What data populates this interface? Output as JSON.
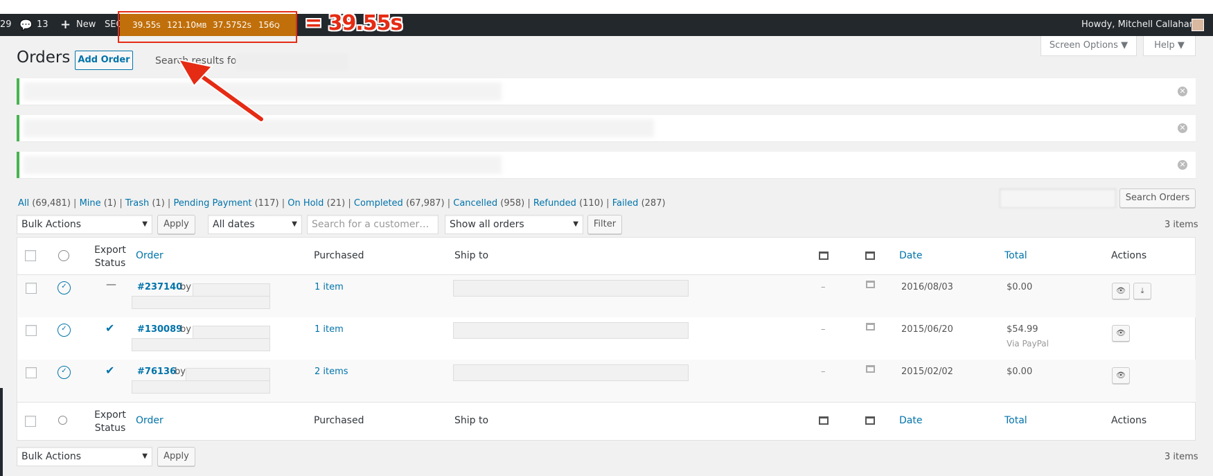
{
  "adminbar": {
    "updates_count": "29",
    "comments_count": "13",
    "new_label": "New",
    "seo_label": "SEO",
    "qm_time": "39.55",
    "qm_time_unit": "S",
    "qm_memory": "121.10",
    "qm_memory_unit": "MB",
    "qm_db_time": "37.5752",
    "qm_db_time_unit": "S",
    "qm_queries": "156",
    "qm_queries_unit": "Q",
    "howdy": "Howdy, Mitchell Callahan"
  },
  "annotation": {
    "callout": "= 39.55s",
    "color": "#e52b14"
  },
  "screen_meta": {
    "screen_options": "Screen Options",
    "help": "Help"
  },
  "page": {
    "title": "Orders",
    "add_order": "Add Order",
    "search_results_prefix": "Search results for"
  },
  "views": [
    {
      "label": "All",
      "count": "(69,481)"
    },
    {
      "label": "Mine",
      "count": "(1)"
    },
    {
      "label": "Trash",
      "count": "(1)"
    },
    {
      "label": "Pending Payment",
      "count": "(117)"
    },
    {
      "label": "On Hold",
      "count": "(21)"
    },
    {
      "label": "Completed",
      "count": "(67,987)"
    },
    {
      "label": "Cancelled",
      "count": "(958)"
    },
    {
      "label": "Refunded",
      "count": "(110)"
    },
    {
      "label": "Failed",
      "count": "(287)"
    }
  ],
  "search": {
    "button": "Search Orders"
  },
  "filters": {
    "bulk_actions": "Bulk Actions",
    "apply": "Apply",
    "dates": "All dates",
    "customer_placeholder": "Search for a customer…",
    "orders_filter": "Show all orders",
    "filter": "Filter",
    "items_count": "3 items"
  },
  "table": {
    "headers": {
      "export_status": "Export Status",
      "order": "Order",
      "purchased": "Purchased",
      "ship_to": "Ship to",
      "date": "Date",
      "total": "Total",
      "actions": "Actions"
    },
    "rows": [
      {
        "export": "—",
        "order": "#237140",
        "by": "by",
        "purchased": "1 item",
        "dash": "–",
        "date": "2016/08/03",
        "total": "$0.00",
        "via": ""
      },
      {
        "export": "✔",
        "order": "#130089",
        "by": "by",
        "purchased": "1 item",
        "dash": "–",
        "date": "2015/06/20",
        "total": "$54.99",
        "via": "Via PayPal"
      },
      {
        "export": "✔",
        "order": "#76136",
        "by": "by",
        "purchased": "2 items",
        "dash": "–",
        "date": "2015/02/02",
        "total": "$0.00",
        "via": ""
      }
    ]
  },
  "colors": {
    "adminbar": "#23282d",
    "query_monitor": "#c06f0a",
    "link": "#0073aa",
    "notice": "#46b450"
  }
}
